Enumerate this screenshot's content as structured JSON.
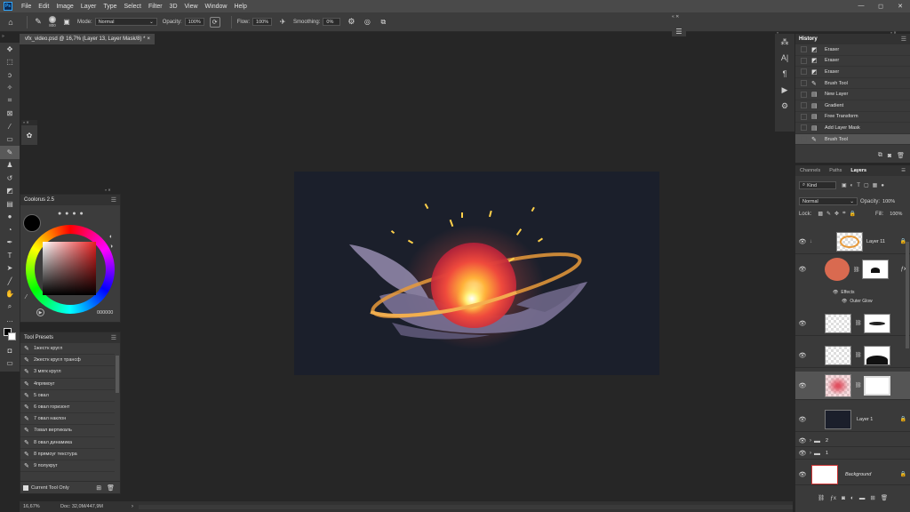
{
  "app": {
    "logo": "Ps"
  },
  "menu": [
    "File",
    "Edit",
    "Image",
    "Layer",
    "Type",
    "Select",
    "Filter",
    "3D",
    "View",
    "Window",
    "Help"
  ],
  "window_controls": [
    "—",
    "◻",
    "✕"
  ],
  "options": {
    "brush_size": "800",
    "mode_label": "Mode:",
    "mode_value": "Normal",
    "opacity_label": "Opacity:",
    "opacity_value": "100%",
    "flow_label": "Flow:",
    "flow_value": "100%",
    "smoothing_label": "Smoothing:",
    "smoothing_value": "0%"
  },
  "doc_tab": {
    "title": "vfx_video.psd @ 16,7% (Layer 13, Layer Mask/8) *",
    "close": "×"
  },
  "tools": [
    "move-icon",
    "marquee-icon",
    "lasso-icon",
    "quick-select-icon",
    "crop-icon",
    "frame-icon",
    "eyedropper-icon",
    "healing-icon",
    "brush-icon",
    "stamp-icon",
    "history-brush-icon",
    "eraser-icon",
    "gradient-icon",
    "blur-icon",
    "dodge-icon",
    "pen-icon",
    "type-icon",
    "path-select-icon",
    "shape-icon",
    "hand-icon",
    "zoom-icon"
  ],
  "coolorus": {
    "title": "Coolorus 2.5",
    "hex_value": "000000"
  },
  "presets": {
    "title": "Tool Presets",
    "items": [
      "1жестк кругл",
      "2жестк кругл трансф",
      "3 мягк кругл",
      "4прямоуг",
      "5 овал",
      "6 овал горизонт",
      "7 овал наклон",
      "7овал вертикаль",
      "8 овал динамика",
      "8 прямоуг текстура",
      "9 полукруг"
    ],
    "current_only": "Current Tool Only"
  },
  "status": {
    "zoom": "16,67%",
    "doc": "Doc: 32,0M/447,9M"
  },
  "history": {
    "title": "History",
    "items": [
      "Eraser",
      "Eraser",
      "Eraser",
      "Brush Tool",
      "New Layer",
      "Gradient",
      "Free Transform",
      "Add Layer Mask",
      "Brush Tool"
    ],
    "icons": [
      "eraser-icon",
      "eraser-icon",
      "eraser-icon",
      "brush-icon",
      "doc-icon",
      "doc-icon",
      "doc-icon",
      "doc-icon",
      "brush-icon"
    ]
  },
  "layers_panel": {
    "tabs": [
      "Channels",
      "Paths",
      "Layers"
    ],
    "filter_kind": "Kind",
    "blend_mode": "Normal",
    "opacity_label": "Opacity:",
    "opacity_value": "100%",
    "lock_label": "Lock:",
    "fill_label": "Fill:",
    "fill_value": "100%",
    "layers": {
      "layer11": "Layer 11",
      "effects": "Effects",
      "outer_glow": "Outer Glow",
      "layer1": "Layer 1",
      "group2": "2",
      "group1": "1",
      "background": "Background"
    }
  },
  "colors": {
    "accent": "#31a8ff",
    "canvas_bg": "#1b1f2b",
    "glow_core": "#ffe680",
    "glow_red": "#e8383c",
    "smoke": "#7b7296",
    "ring": "#e89a3a"
  }
}
